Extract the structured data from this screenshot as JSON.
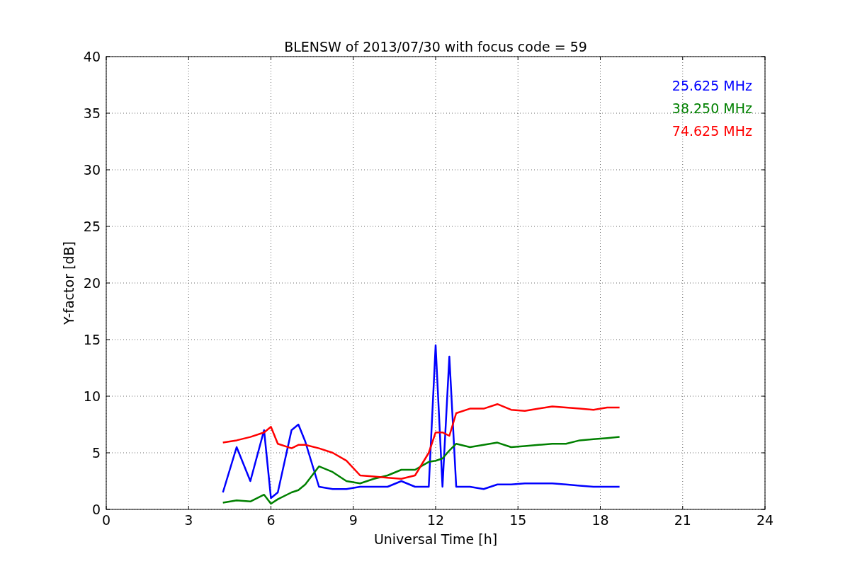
{
  "figure": {
    "chart_data": {
      "type": "line",
      "title": "BLENSW of 2013/07/30 with focus code = 59",
      "xlabel": "Universal Time [h]",
      "ylabel": "Y-factor [dB]",
      "x": [
        4.25,
        4.75,
        5.25,
        5.75,
        6.0,
        6.25,
        6.75,
        7.0,
        7.25,
        7.75,
        8.25,
        8.75,
        9.25,
        9.75,
        10.25,
        10.75,
        11.25,
        11.75,
        12.0,
        12.25,
        12.5,
        12.75,
        13.25,
        13.75,
        14.25,
        14.75,
        15.25,
        15.75,
        16.25,
        16.75,
        17.25,
        17.75,
        18.25,
        18.7
      ],
      "series": [
        {
          "name": "25.625 MHz",
          "color": "#0000ff",
          "values": [
            1.5,
            5.5,
            2.5,
            7,
            1,
            1.5,
            7,
            7.5,
            6,
            2,
            1.8,
            1.8,
            2,
            2,
            2,
            2.5,
            2,
            2,
            14.5,
            2,
            13.5,
            2,
            2,
            1.8,
            2.2,
            2.2,
            2.3,
            2.3,
            2.3,
            2.2,
            2.1,
            2.0,
            2.0,
            2.0
          ]
        },
        {
          "name": "38.250 MHz",
          "color": "#008000",
          "values": [
            0.6,
            0.8,
            0.7,
            1.3,
            0.5,
            0.9,
            1.5,
            1.7,
            2.2,
            3.8,
            3.3,
            2.5,
            2.3,
            2.7,
            3.0,
            3.5,
            3.5,
            4.2,
            4.3,
            4.5,
            5.2,
            5.8,
            5.5,
            5.7,
            5.9,
            5.5,
            5.6,
            5.7,
            5.8,
            5.8,
            6.1,
            6.2,
            6.3,
            6.4
          ]
        },
        {
          "name": "74.625 MHz",
          "color": "#ff0000",
          "values": [
            5.9,
            6.1,
            6.4,
            6.8,
            7.3,
            5.8,
            5.4,
            5.7,
            5.7,
            5.4,
            5.0,
            4.3,
            3.0,
            2.9,
            2.8,
            2.7,
            3.0,
            5.0,
            6.8,
            6.8,
            6.5,
            8.5,
            8.9,
            8.9,
            9.3,
            8.8,
            8.7,
            8.9,
            9.1,
            9.0,
            8.9,
            8.8,
            9.0,
            9.0
          ]
        }
      ],
      "xlim": [
        0,
        24
      ],
      "ylim": [
        0,
        40
      ],
      "xticks": [
        0,
        3,
        6,
        9,
        12,
        15,
        18,
        21,
        24
      ],
      "yticks": [
        0,
        5,
        10,
        15,
        20,
        25,
        30,
        35,
        40
      ],
      "grid": true
    }
  }
}
